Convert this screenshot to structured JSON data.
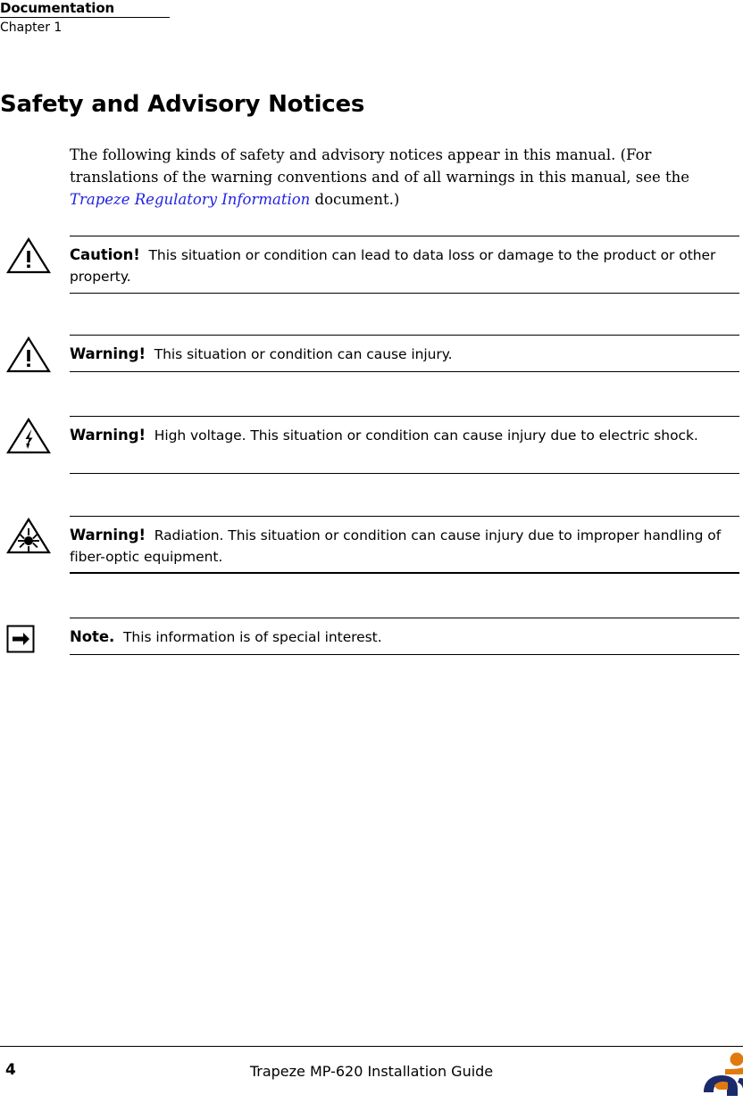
{
  "header": {
    "doc_label": "Documentation",
    "chapter_label": "Chapter 1"
  },
  "section": {
    "title": "Safety and Advisory Notices"
  },
  "intro": {
    "text_before": "The following kinds of safety and advisory notices appear in this manual. (For translations of the warning conventions and of all warnings in this manual, see the ",
    "xref": "Trapeze Regulatory Information",
    "text_after": " document.)"
  },
  "notices": [
    {
      "icon": "caution-triangle-icon",
      "label": "Caution!",
      "text": "This situation or condition can lead to data loss or damage to the product or other property."
    },
    {
      "icon": "warning-triangle-icon",
      "label": "Warning!",
      "text": "This situation or condition can cause injury."
    },
    {
      "icon": "high-voltage-icon",
      "label": "Warning!",
      "text": "High voltage. This situation or condition can cause injury due to electric shock."
    },
    {
      "icon": "laser-radiation-icon",
      "label": "Warning!",
      "text": "Radiation. This situation or condition can cause injury due to improper handling of fiber-optic equipment."
    },
    {
      "icon": "note-arrow-icon",
      "label": "Note.",
      "text": "This information is of special interest."
    }
  ],
  "footer": {
    "page_number": "4",
    "guide_title": "Trapeze MP-620 Installation Guide",
    "logo_name": "trapeze-networks-logo"
  },
  "colors": {
    "xref_blue": "#2222e2",
    "logo_orange": "#e07a10",
    "logo_navy": "#1b2a6b",
    "rule_black": "#000000"
  }
}
